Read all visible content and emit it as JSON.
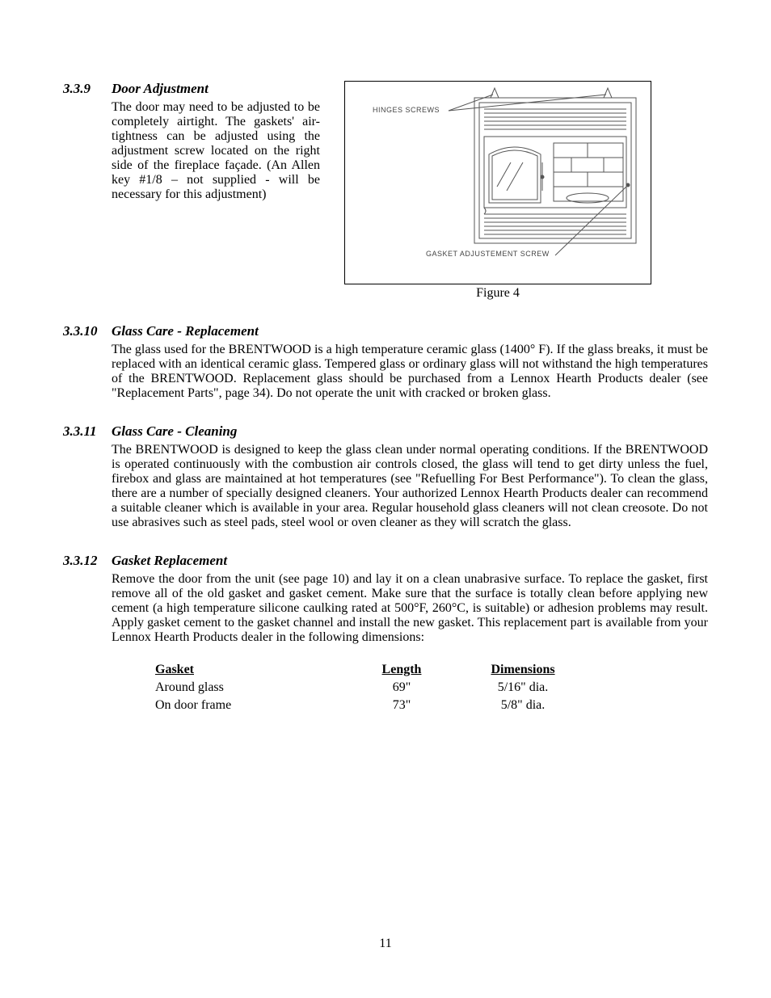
{
  "sections": {
    "s339": {
      "num": "3.3.9",
      "title": "Door Adjustment",
      "body": "The door may need to be adjusted to be completely airtight. The gaskets' air-tightness can be adjusted using the adjustment screw located on the right side of the fireplace façade. (An Allen key #1/8 – not supplied - will be necessary for this adjustment)"
    },
    "s3310": {
      "num": "3.3.10",
      "title": "Glass Care - Replacement",
      "body": "The glass used for the BRENTWOOD is a high temperature ceramic glass (1400° F).  If the glass breaks, it must be replaced with an identical ceramic glass.  Tempered glass or ordinary glass will not withstand the high temperatures of the BRENTWOOD.  Replacement glass should be purchased from a Lennox Hearth Products dealer (see \"Replacement Parts\", page 34).  Do not operate the unit with cracked or broken glass."
    },
    "s3311": {
      "num": "3.3.11",
      "title": "Glass Care - Cleaning",
      "body": "The BRENTWOOD is designed to keep the glass clean under normal operating conditions. If the BRENTWOOD is operated continuously with the combustion air controls closed, the glass will tend to get dirty unless the fuel, firebox and glass are maintained at hot temperatures (see \"Refuelling For Best Performance\").  To clean the glass, there are a number of specially designed cleaners.  Your authorized Lennox Hearth Products dealer can recommend a suitable cleaner which is available in your area.  Regular household glass cleaners will not clean creosote.  Do not use abrasives such as steel pads, steel wool or oven cleaner as they will scratch the glass."
    },
    "s3312": {
      "num": "3.3.12",
      "title": "Gasket Replacement",
      "body": "Remove the door from the unit (see page 10) and lay it on a clean unabrasive surface. To replace the gasket, first remove all of the old gasket and gasket cement.  Make sure that the surface is totally clean before applying new cement (a high temperature silicone caulking rated at 500°F, 260°C, is suitable) or adhesion problems may result.  Apply gasket cement to the gasket channel and install the new gasket.  This replacement part is available from your Lennox Hearth Products dealer in the following dimensions:"
    }
  },
  "figure": {
    "caption": "Figure 4",
    "label_hinges": "HINGES SCREWS",
    "label_gasket": "GASKET ADJUSTEMENT SCREW"
  },
  "gasket_table": {
    "headers": {
      "gasket": "Gasket",
      "length": "Length",
      "dimensions": "Dimensions"
    },
    "rows": [
      {
        "gasket": "Around glass",
        "length": "69\"",
        "dimensions": "5/16\" dia."
      },
      {
        "gasket": "On door frame",
        "length": "73\"",
        "dimensions": "5/8\" dia."
      }
    ]
  },
  "page_number": "11"
}
